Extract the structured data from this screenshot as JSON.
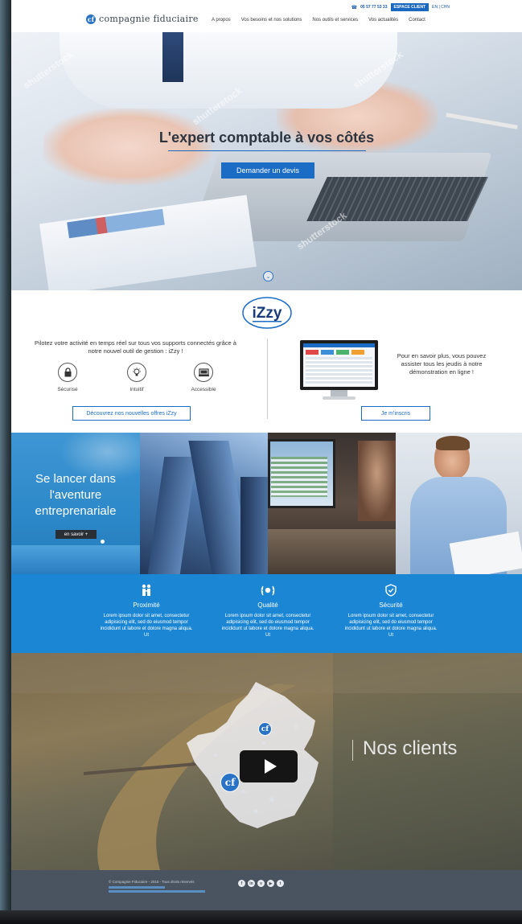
{
  "header": {
    "phone": "05 57 77 53 33",
    "client_button": "ESPACE CLIENT",
    "language": "EN | CHN",
    "logo_text": "compagnie fiduciaire",
    "nav": [
      "A propos",
      "Vos besoins et nos solutions",
      "Nos outils et services",
      "Vos actualités",
      "Contact"
    ]
  },
  "hero": {
    "title": "L'expert comptable à vos côtés",
    "cta": "Demander un devis"
  },
  "izzy": {
    "logo": "iZzy",
    "intro": "Pilotez votre activité en temps réel sur tous vos supports connectés grâce à notre nouvel outil de gestion : iZzy !",
    "features": [
      {
        "icon": "lock-icon",
        "label": "Sécurisé"
      },
      {
        "icon": "lightbulb-icon",
        "label": "Intuitif"
      },
      {
        "icon": "devices-icon",
        "label": "Accessible"
      }
    ],
    "offers_button": "Découvrez nos nouvelles offres iZzy",
    "demo_text": "Pour en savoir plus, vous pouvez assister tous les jeudis à notre démonstration en ligne !",
    "signup_button": "Je m'inscris"
  },
  "entrepreneur": {
    "title": "Se lancer dans l'aventure entreprenariale",
    "button": "en savoir +"
  },
  "values": [
    {
      "icon": "people-icon",
      "title": "Proximité",
      "text": "Lorem ipsum dolor sit amet, consectetur adipisicing elit, sed do eiusmod tempor incididunt ut labore et dolore magna aliqua. Ut"
    },
    {
      "icon": "laurel-icon",
      "title": "Qualité",
      "text": "Lorem ipsum dolor sit amet, consectetur adipisicing elit, sed do eiusmod tempor incididunt ut labore et dolore magna aliqua. Ut"
    },
    {
      "icon": "shield-icon",
      "title": "Sécurité",
      "text": "Lorem ipsum dolor sit amet, consectetur adipisicing elit, sed do eiusmod tempor incididunt ut labore et dolore magna aliqua. Ut"
    }
  ],
  "clients": {
    "title": "Nos clients"
  },
  "footer": {
    "copyright": "© Compagnie Fiduciaire - 2015 - Tous droits réservés",
    "social": [
      "facebook-icon",
      "linkedin-icon",
      "viadeo-icon",
      "youtube-icon",
      "twitter-icon"
    ]
  },
  "colors": {
    "brand_blue": "#1b6cc5",
    "values_band": "#1b86d3",
    "footer": "#4a5460"
  }
}
